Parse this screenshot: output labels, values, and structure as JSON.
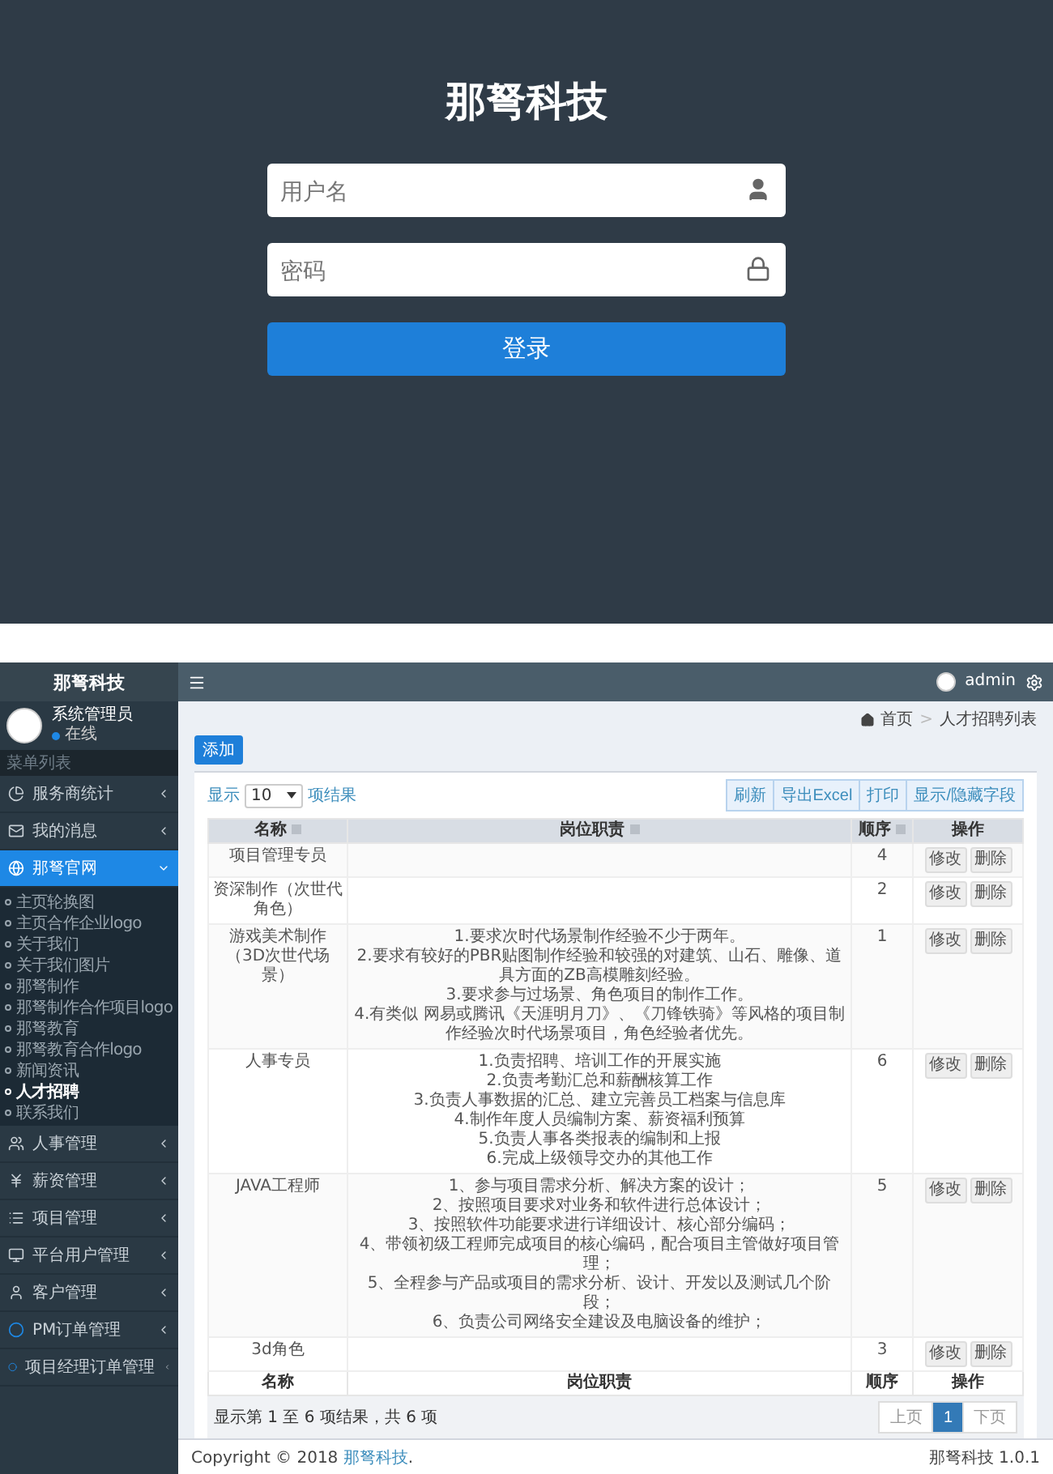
{
  "login": {
    "title": "那弩科技",
    "username_placeholder": "用户名",
    "password_placeholder": "密码",
    "button": "登录"
  },
  "admin": {
    "brand": "那弩科技",
    "topbar": {
      "user": "admin"
    },
    "sidebar": {
      "user_name": "系统管理员",
      "status": "在线",
      "menu_label": "菜单列表",
      "items": [
        {
          "label": "服务商统计",
          "kind": "chart",
          "selected": false,
          "expanded": false
        },
        {
          "label": "我的消息",
          "kind": "mail",
          "selected": false,
          "expanded": false
        },
        {
          "label": "那弩官网",
          "kind": "globe",
          "selected": true,
          "expanded": true,
          "children": [
            {
              "label": "主页轮换图",
              "selected": false
            },
            {
              "label": "主页合作企业logo",
              "selected": false
            },
            {
              "label": "关于我们",
              "selected": false
            },
            {
              "label": "关于我们图片",
              "selected": false
            },
            {
              "label": "那弩制作",
              "selected": false
            },
            {
              "label": "那弩制作合作项目logo",
              "selected": false
            },
            {
              "label": "那弩教育",
              "selected": false
            },
            {
              "label": "那弩教育合作logo",
              "selected": false
            },
            {
              "label": "新闻资讯",
              "selected": false
            },
            {
              "label": "人才招聘",
              "selected": true
            },
            {
              "label": "联系我们",
              "selected": false
            }
          ]
        },
        {
          "label": "人事管理",
          "kind": "users",
          "selected": false,
          "expanded": false
        },
        {
          "label": "薪资管理",
          "kind": "yen",
          "selected": false,
          "expanded": false
        },
        {
          "label": "项目管理",
          "kind": "list",
          "selected": false,
          "expanded": false
        },
        {
          "label": "平台用户管理",
          "kind": "monitor",
          "selected": false,
          "expanded": false
        },
        {
          "label": "客户管理",
          "kind": "user",
          "selected": false,
          "expanded": false
        },
        {
          "label": "PM订单管理",
          "kind": "circle",
          "selected": false,
          "expanded": false
        },
        {
          "label": "项目经理订单管理",
          "kind": "circle",
          "selected": false,
          "expanded": false
        }
      ]
    },
    "breadcrumb": {
      "home": "首页",
      "separator": ">",
      "current": "人才招聘列表"
    },
    "add_button": "添加",
    "length_menu": {
      "before": "显示",
      "value": "10",
      "after": "项结果"
    },
    "tool_buttons": [
      "刷新",
      "导出Excel",
      "打印",
      "显示/隐藏字段"
    ],
    "table": {
      "columns": [
        {
          "label": "名称",
          "sortable": true
        },
        {
          "label": "岗位职责",
          "sortable": true
        },
        {
          "label": "顺序",
          "sortable": true
        },
        {
          "label": "操作",
          "sortable": false
        }
      ],
      "rows": [
        {
          "name": "项目管理专员",
          "order": "4",
          "actions": [
            "修改",
            "删除"
          ]
        },
        {
          "name": "资深制作（次世代角色）",
          "order": "2",
          "actions": [
            "修改",
            "删除"
          ]
        },
        {
          "name": "游戏美术制作（3D次世代场景）",
          "order": "1",
          "actions": [
            "修改",
            "删除"
          ],
          "duties": [
            "1.要求次时代场景制作经验不少于两年。",
            "2.要求有较好的PBR贴图制作经验和较强的对建筑、山石、雕像、道具方面的ZB高模雕刻经验。",
            "3.要求参与过场景、角色项目的制作工作。",
            "4.有类似 网易或腾讯《天涯明月刀》、《刀锋铁骑》等风格的项目制作经验次时代场景项目，角色经验者优先。"
          ]
        },
        {
          "name": "人事专员",
          "order": "6",
          "actions": [
            "修改",
            "删除"
          ],
          "duties": [
            "1.负责招聘、培训工作的开展实施",
            "2.负责考勤汇总和薪酬核算工作",
            "3.负责人事数据的汇总、建立完善员工档案与信息库",
            "4.制作年度人员编制方案、薪资福利预算",
            "5.负责人事各类报表的编制和上报",
            "6.完成上级领导交办的其他工作"
          ]
        },
        {
          "name": "JAVA工程师",
          "order": "5",
          "actions": [
            "修改",
            "删除"
          ],
          "duties": [
            "1、参与项目需求分析、解决方案的设计；",
            "2、按照项目要求对业务和软件进行总体设计；",
            "3、按照软件功能要求进行详细设计、核心部分编码；",
            "4、带领初级工程师完成项目的核心编码，配合项目主管做好项目管理；",
            "5、全程参与产品或项目的需求分析、设计、开发以及测试几个阶段；",
            "6、负责公司网络安全建设及电脑设备的维护；"
          ]
        },
        {
          "name": "3d角色",
          "order": "3",
          "actions": [
            "修改",
            "删除"
          ]
        }
      ],
      "footer_columns": [
        "名称",
        "岗位职责",
        "顺序",
        "操作"
      ]
    },
    "info": "显示第 1 至 6 项结果，共 6 项",
    "pagination": [
      {
        "label": "上页",
        "selected": false
      },
      {
        "label": "1",
        "selected": true
      },
      {
        "label": "下页",
        "selected": false
      }
    ],
    "footer": {
      "copyright": "Copyright © 2018",
      "link": "那弩科技",
      "tail": ".",
      "version": "那弩科技 1.0.1"
    }
  }
}
